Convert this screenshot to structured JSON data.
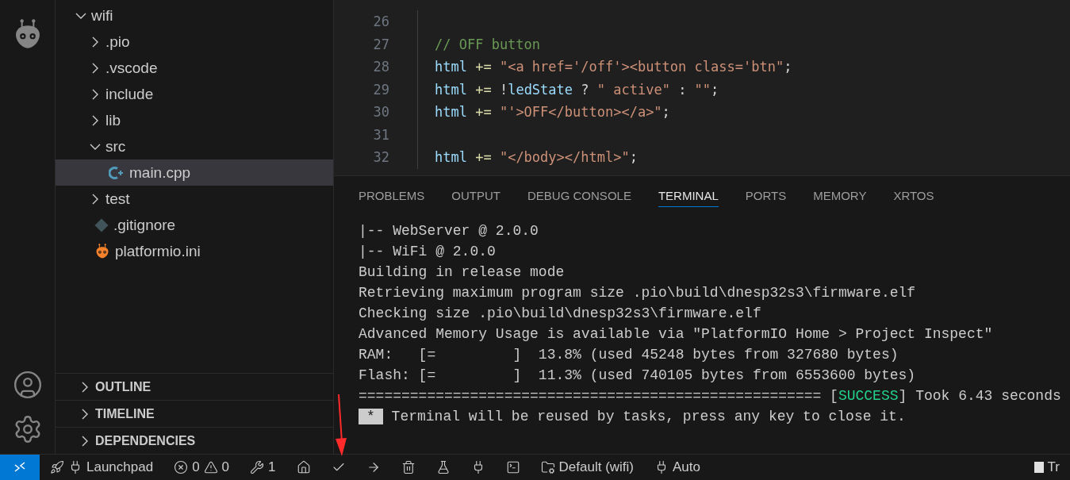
{
  "explorer": {
    "tree": [
      {
        "label": "wifi",
        "kind": "folder",
        "expanded": true,
        "selected": false,
        "children": [
          {
            "label": ".pio",
            "kind": "folder",
            "expanded": false,
            "selected": false
          },
          {
            "label": ".vscode",
            "kind": "folder",
            "expanded": false,
            "selected": false
          },
          {
            "label": "include",
            "kind": "folder",
            "expanded": false,
            "selected": false
          },
          {
            "label": "lib",
            "kind": "folder",
            "expanded": false,
            "selected": false
          },
          {
            "label": "src",
            "kind": "folder",
            "expanded": true,
            "selected": false,
            "children": [
              {
                "label": "main.cpp",
                "kind": "cpp",
                "selected": true
              }
            ]
          },
          {
            "label": "test",
            "kind": "folder",
            "expanded": false,
            "selected": false
          },
          {
            "label": ".gitignore",
            "kind": "git",
            "selected": false
          },
          {
            "label": "platformio.ini",
            "kind": "pio",
            "selected": false
          }
        ]
      }
    ],
    "sections": [
      {
        "label": "OUTLINE",
        "expanded": false
      },
      {
        "label": "TIMELINE",
        "expanded": false
      },
      {
        "label": "DEPENDENCIES",
        "expanded": false
      }
    ]
  },
  "editor": {
    "lines": [
      {
        "number": "26"
      },
      {
        "number": "27",
        "tokens": [
          {
            "text": "// OFF button",
            "kind": "comment"
          }
        ]
      },
      {
        "number": "28",
        "tokens": [
          {
            "text": "html",
            "kind": "var"
          },
          {
            "text": " += ",
            "kind": "op"
          },
          {
            "text": "\"<a href='/off'><button class='btn\"",
            "kind": "string"
          },
          {
            "text": ";",
            "kind": "plain"
          }
        ]
      },
      {
        "number": "29",
        "tokens": [
          {
            "text": "html",
            "kind": "var"
          },
          {
            "text": " += ",
            "kind": "op"
          },
          {
            "text": "!",
            "kind": "plain"
          },
          {
            "text": "ledState",
            "kind": "var"
          },
          {
            "text": " ? ",
            "kind": "plain"
          },
          {
            "text": "\" active\"",
            "kind": "string"
          },
          {
            "text": " : ",
            "kind": "plain"
          },
          {
            "text": "\"\"",
            "kind": "string"
          },
          {
            "text": ";",
            "kind": "plain"
          }
        ]
      },
      {
        "number": "30",
        "tokens": [
          {
            "text": "html",
            "kind": "var"
          },
          {
            "text": " += ",
            "kind": "op"
          },
          {
            "text": "\"'>OFF</button></a>\"",
            "kind": "string"
          },
          {
            "text": ";",
            "kind": "plain"
          }
        ]
      },
      {
        "number": "31"
      },
      {
        "number": "32",
        "tokens": [
          {
            "text": "html",
            "kind": "var"
          },
          {
            "text": " += ",
            "kind": "op"
          },
          {
            "text": "\"</body></html>\"",
            "kind": "string"
          },
          {
            "text": ";",
            "kind": "plain"
          }
        ]
      }
    ]
  },
  "panel": {
    "tabs": [
      {
        "label": "PROBLEMS",
        "selected": false
      },
      {
        "label": "OUTPUT",
        "selected": false
      },
      {
        "label": "DEBUG CONSOLE",
        "selected": false
      },
      {
        "label": "TERMINAL",
        "selected": true
      },
      {
        "label": "PORTS",
        "selected": false
      },
      {
        "label": "MEMORY",
        "selected": false
      },
      {
        "label": "XRTOS",
        "selected": false
      }
    ],
    "terminal": {
      "lines": [
        {
          "segments": [
            {
              "text": "|-- WebServer @ 2.0.0",
              "kind": "plain"
            }
          ]
        },
        {
          "segments": [
            {
              "text": "|-- WiFi @ 2.0.0",
              "kind": "plain"
            }
          ]
        },
        {
          "segments": [
            {
              "text": "Building in release mode",
              "kind": "plain"
            }
          ]
        },
        {
          "segments": [
            {
              "text": "Retrieving maximum program size .pio\\build\\dnesp32s3\\firmware.elf",
              "kind": "plain"
            }
          ]
        },
        {
          "segments": [
            {
              "text": "Checking size .pio\\build\\dnesp32s3\\firmware.elf",
              "kind": "plain"
            }
          ]
        },
        {
          "segments": [
            {
              "text": "Advanced Memory Usage is available via \"PlatformIO Home > Project Inspect\"",
              "kind": "plain"
            }
          ]
        },
        {
          "segments": [
            {
              "text": "RAM:   [=         ]  13.8% (used 45248 bytes from 327680 bytes)",
              "kind": "plain"
            }
          ]
        },
        {
          "segments": [
            {
              "text": "Flash: [=         ]  11.3% (used 740105 bytes from 6553600 bytes)",
              "kind": "plain"
            }
          ]
        },
        {
          "segments": [
            {
              "text": "====================================================== [",
              "kind": "plain"
            },
            {
              "text": "SUCCESS",
              "kind": "success"
            },
            {
              "text": "] Took 6.43 seconds",
              "kind": "plain"
            }
          ]
        },
        {
          "segments": [
            {
              "text": "*",
              "kind": "badge"
            },
            {
              "text": " Terminal will be reused by tasks, press any key to close it.",
              "kind": "plain"
            }
          ]
        }
      ]
    }
  },
  "status_bar": {
    "items": [
      {
        "kind": "remote"
      },
      {
        "kind": "launchpad",
        "text": "Launchpad"
      },
      {
        "kind": "problems",
        "errors": "0",
        "warnings": "0"
      },
      {
        "kind": "tasks",
        "text": "1"
      },
      {
        "kind": "home"
      },
      {
        "kind": "build"
      },
      {
        "kind": "upload"
      },
      {
        "kind": "clean"
      },
      {
        "kind": "test"
      },
      {
        "kind": "monitor"
      },
      {
        "kind": "terminal"
      },
      {
        "kind": "env",
        "text": "Default (wifi)"
      },
      {
        "kind": "port",
        "text": "Auto"
      },
      {
        "kind": "right",
        "text": "Tr"
      }
    ]
  }
}
